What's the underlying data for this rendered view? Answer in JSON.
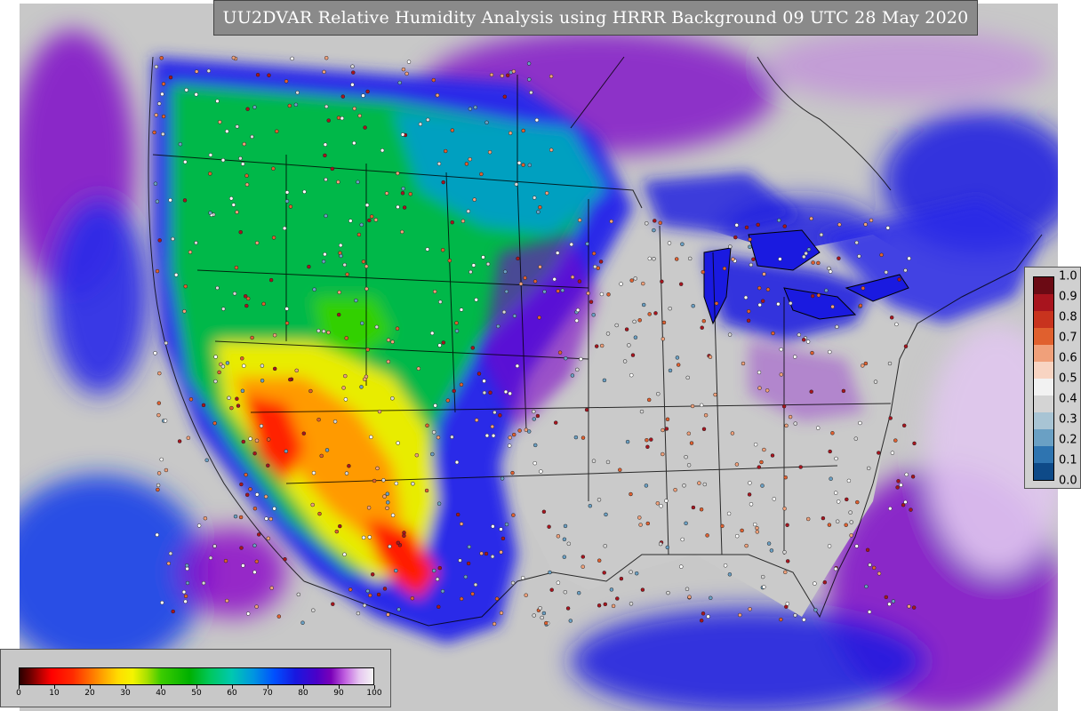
{
  "title": "UU2DVAR Relative Humidity Analysis using HRRR Background 09 UTC 28 May 2020",
  "rh_colorbar": {
    "ticks": [
      "0",
      "10",
      "20",
      "30",
      "40",
      "50",
      "60",
      "70",
      "80",
      "90",
      "100"
    ]
  },
  "prob_colorbar": {
    "labels": [
      "1.0",
      "0.9",
      "0.8",
      "0.7",
      "0.6",
      "0.5",
      "0.4",
      "0.3",
      "0.2",
      "0.1",
      "0.0"
    ],
    "colors": [
      "#6b0a14",
      "#a8141e",
      "#c8331e",
      "#e0602e",
      "#f0a07a",
      "#f8d4c2",
      "#f2f2f2",
      "#d4d4d4",
      "#a8c4d4",
      "#6aa0c4",
      "#2e74b0",
      "#0e4a88"
    ]
  },
  "colors": {
    "ocean": "#c8c8c8",
    "panel": "#8a8a8a",
    "dry": "#ff0000",
    "moist": "#1a1ae0",
    "saturated": "#e6c6f0"
  }
}
